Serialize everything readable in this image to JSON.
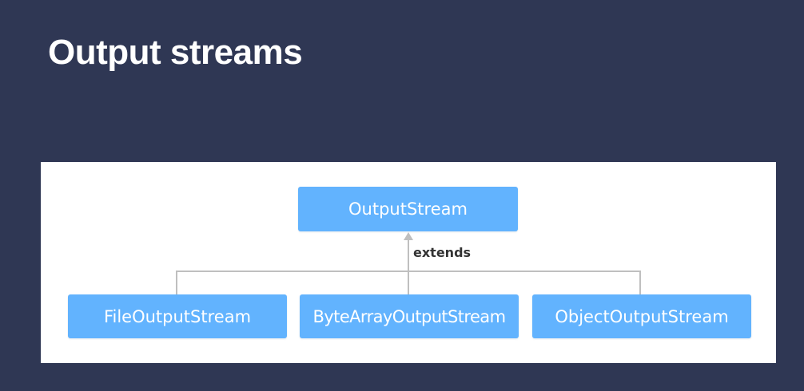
{
  "slide": {
    "title": "Output streams"
  },
  "diagram": {
    "parent": {
      "label": "OutputStream"
    },
    "relation_label": "extends",
    "children": [
      {
        "label": "FileOutputStream"
      },
      {
        "label": "ByteArrayOutputStream"
      },
      {
        "label": "ObjectOutputStream"
      }
    ],
    "colors": {
      "background": "#2f3754",
      "panel": "#ffffff",
      "node_fill": "#62b3fe",
      "node_text": "#ffffff",
      "connector": "#bfbfbf",
      "label_text": "#333333"
    }
  }
}
